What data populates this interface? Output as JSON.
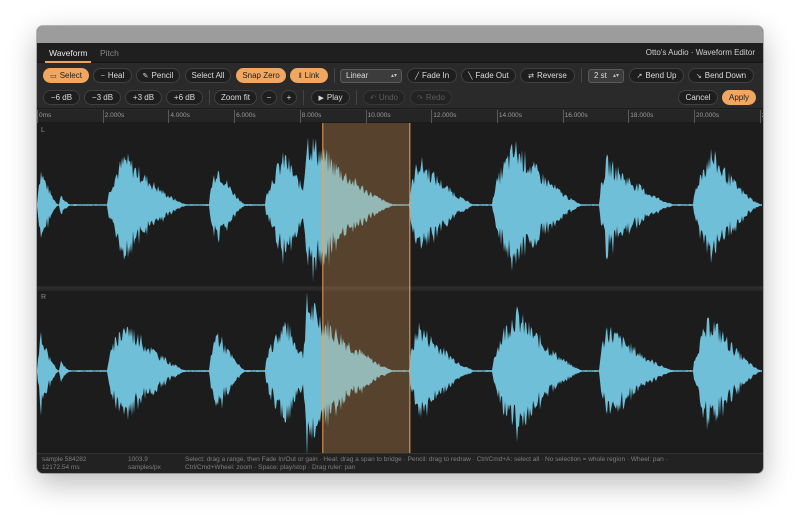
{
  "tabs": [
    {
      "label": "Waveform",
      "active": true
    },
    {
      "label": "Pitch",
      "active": false
    }
  ],
  "app_title": "Otto's Audio · Waveform Editor",
  "toolbar1": {
    "select": "Select",
    "heal": "Heal",
    "pencil": "Pencil",
    "select_all": "Select All",
    "snap_zero": "Snap Zero",
    "link": "Link",
    "curve_select": "Linear",
    "fade_in": "Fade In",
    "fade_out": "Fade Out",
    "reverse": "Reverse",
    "semitone_select": "2 st",
    "bend_up": "Bend Up",
    "bend_down": "Bend Down"
  },
  "toolbar2": {
    "gain_m6": "−6 dB",
    "gain_m3": "−3 dB",
    "gain_p3": "+3 dB",
    "gain_p6": "+6 dB",
    "zoom_fit": "Zoom fit",
    "zoom_out": "−",
    "zoom_in": "+",
    "play": "Play",
    "undo": "Undo",
    "redo": "Redo",
    "cancel": "Cancel",
    "apply": "Apply"
  },
  "ruler": {
    "labels": [
      "0ms",
      "2.000s",
      "4.000s",
      "6.000s",
      "8.000s",
      "10.000s",
      "12.000s",
      "14.000s",
      "16.000s",
      "18.000s",
      "20.000s",
      "22.00"
    ]
  },
  "channels": {
    "left": "L",
    "right": "R"
  },
  "selection": {
    "start_s": 8.7,
    "end_s": 11.35
  },
  "view": {
    "start_s": 0,
    "end_s": 22.1
  },
  "status": {
    "sample": "sample 584282",
    "time": "12172.54 ms",
    "zoom": "1003.9",
    "zoom_unit": "samples/px",
    "help_line1": "Select: drag a range, then Fade In/Out or gain · Heal: drag a span to bridge · Pencil: drag to redraw · Ctrl/Cmd+A: select all · No selection = whole region · Wheel: pan ·",
    "help_line2": "Ctrl/Cmd+Wheel: zoom · Space: play/stop · Drag ruler: pan"
  },
  "colors": {
    "waveform": "#6fbfd8",
    "selection": "#f0a45a",
    "accent": "#f1a75f"
  },
  "icons": {
    "select": "marquee-icon",
    "heal": "heal-icon",
    "pencil": "pencil-icon",
    "link": "link-icon",
    "fade_in": "fade-in-icon",
    "fade_out": "fade-out-icon",
    "reverse": "reverse-icon",
    "bend_up": "bend-up-icon",
    "bend_down": "bend-down-icon",
    "play": "play-icon",
    "undo": "undo-icon",
    "redo": "redo-icon"
  }
}
